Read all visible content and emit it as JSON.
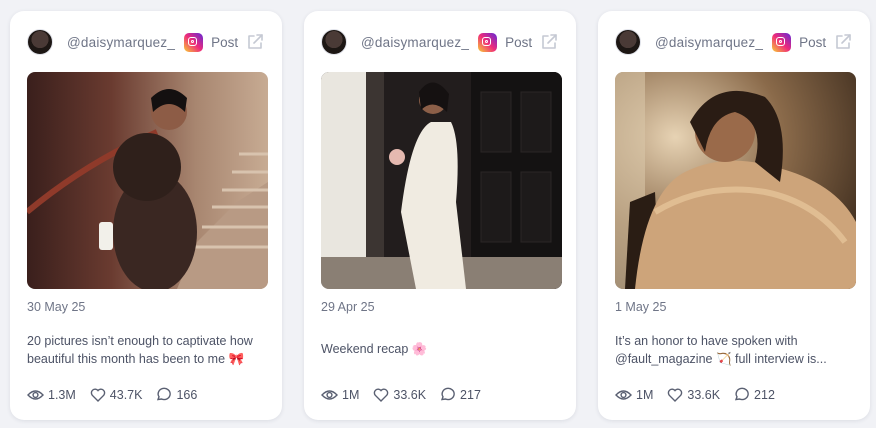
{
  "posts": [
    {
      "handle": "@daisymarquez_",
      "post_type": "Post",
      "date": "30 May 25",
      "caption": "20 pictures isn’t enough to captivate how beautiful this month has been to me 🎀",
      "views": "1.3M",
      "likes": "43.7K",
      "comments": "166",
      "photo_colors": {
        "bg": "#3a2c2a",
        "accent": "#b58a6a",
        "subject": "#2e211c"
      }
    },
    {
      "handle": "@daisymarquez_",
      "post_type": "Post",
      "date": "29 Apr 25",
      "caption": "Weekend recap 🌸",
      "views": "1M",
      "likes": "33.6K",
      "comments": "217",
      "photo_colors": {
        "bg": "#1e1b1b",
        "accent": "#e8e2d6",
        "subject": "#f1ece2"
      }
    },
    {
      "handle": "@daisymarquez_",
      "post_type": "Post",
      "date": "1 May 25",
      "caption": "It’s an honor to have spoken with @fault_magazine 🏹 full interview is...",
      "views": "1M",
      "likes": "33.6K",
      "comments": "212",
      "photo_colors": {
        "bg": "#6b5036",
        "accent": "#e6c49a",
        "subject": "#d9b48a"
      }
    }
  ],
  "icons": {
    "platform": "instagram-icon",
    "external": "external-link-icon",
    "views": "eye-icon",
    "likes": "heart-icon",
    "comments": "comment-icon"
  },
  "colors": {
    "background": "#f1f2f6",
    "card": "#ffffff",
    "muted_text": "#6f7587",
    "body_text": "#4d5366",
    "icon_stroke": "#5a6072"
  }
}
